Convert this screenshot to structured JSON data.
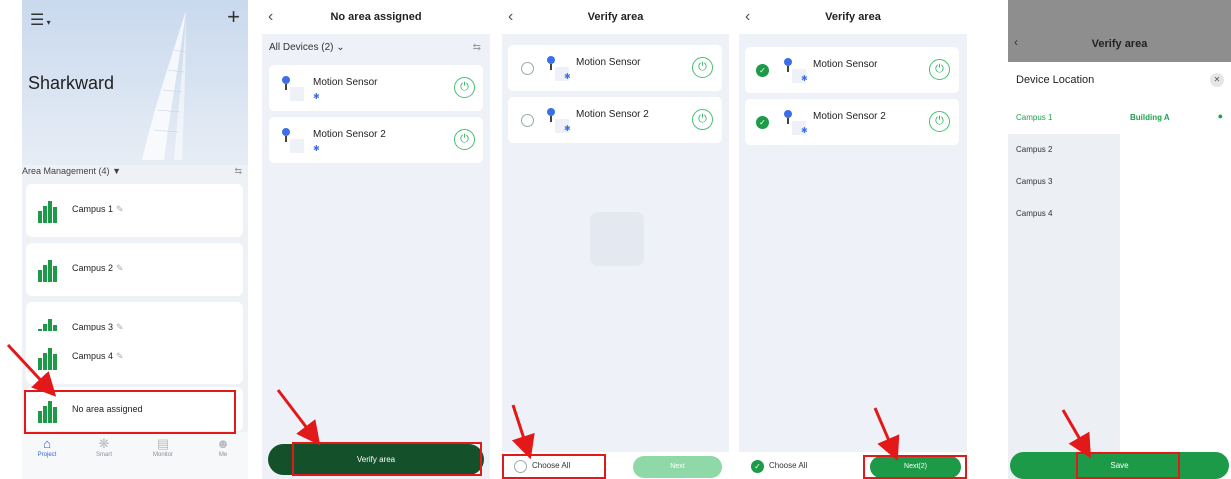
{
  "colors": {
    "accent_green": "#1c9a47",
    "dark_green": "#14502a",
    "annotation_red": "#e31919",
    "active_tab": "#2f62d9"
  },
  "screen_project": {
    "org_name": "Sharkward",
    "area_header": "Area Management (4)",
    "areas": [
      {
        "label": "Campus 1"
      },
      {
        "label": "Campus 2"
      },
      {
        "label": "Campus 3"
      },
      {
        "label": "Campus 4"
      },
      {
        "label": "No area assigned"
      }
    ],
    "tabs": [
      {
        "label": "Project",
        "icon": "home-icon"
      },
      {
        "label": "Smart",
        "icon": "smart-icon"
      },
      {
        "label": "Monitor",
        "icon": "monitor-icon"
      },
      {
        "label": "Me",
        "icon": "person-icon"
      }
    ]
  },
  "screen_unassigned": {
    "title": "No area assigned",
    "filter_label": "All Devices (2)",
    "devices": [
      {
        "name": "Motion Sensor"
      },
      {
        "name": "Motion Sensor 2"
      }
    ],
    "verify_button": "Verify area"
  },
  "screen_verify_empty": {
    "title": "Verify area",
    "devices": [
      {
        "name": "Motion Sensor",
        "selected": false
      },
      {
        "name": "Motion Sensor 2",
        "selected": false
      }
    ],
    "choose_all": "Choose All",
    "next_button": "Next"
  },
  "screen_verify_selected": {
    "title": "Verify area",
    "devices": [
      {
        "name": "Motion Sensor",
        "selected": true
      },
      {
        "name": "Motion Sensor 2",
        "selected": true
      }
    ],
    "choose_all": "Choose All",
    "next_button": "Next(2)"
  },
  "screen_location": {
    "title": "Verify area",
    "sheet_title": "Device Location",
    "locations": [
      "Campus 1",
      "Campus 2",
      "Campus 3",
      "Campus 4"
    ],
    "selected_location": "Campus 1",
    "building": "Building A",
    "save_button": "Save"
  }
}
